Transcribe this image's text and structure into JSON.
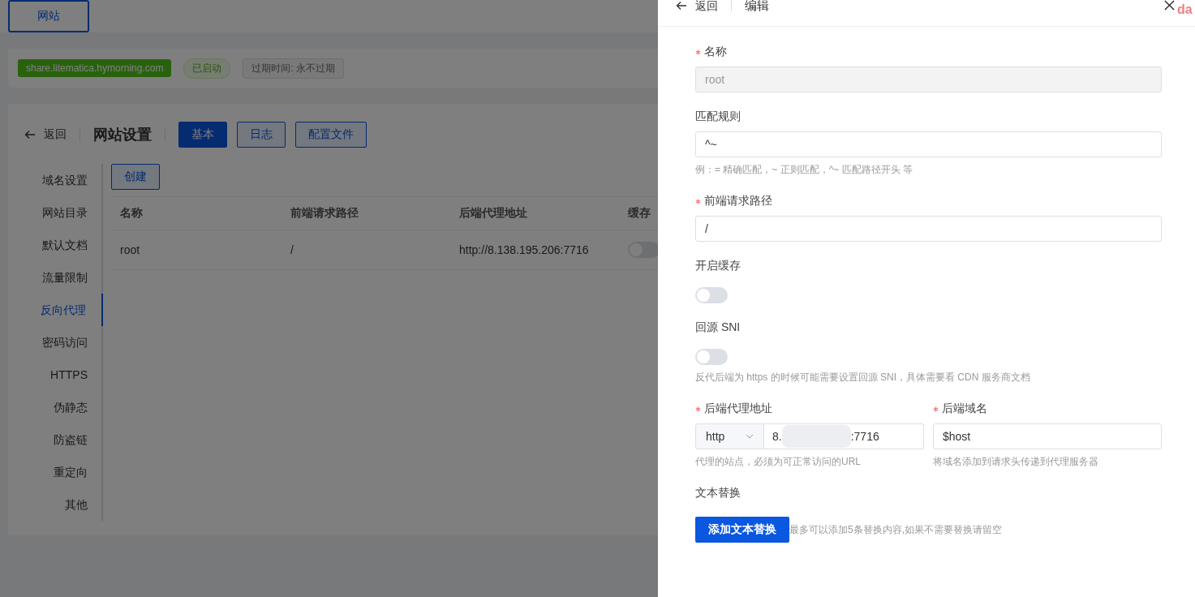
{
  "top_tabs": [
    {
      "label": "网站",
      "selected": true
    }
  ],
  "site": {
    "domain": "share.litematica.hymorning.com",
    "status": "已启动",
    "expiry": "过期时间: 永不过期"
  },
  "settings": {
    "back": "返回",
    "title": "网站设置",
    "tabs": [
      {
        "label": "基本",
        "selected": true
      },
      {
        "label": "日志",
        "selected": false
      },
      {
        "label": "配置文件",
        "selected": false
      }
    ],
    "sidebar": [
      {
        "label": "域名设置",
        "selected": false
      },
      {
        "label": "网站目录",
        "selected": false
      },
      {
        "label": "默认文档",
        "selected": false
      },
      {
        "label": "流量限制",
        "selected": false
      },
      {
        "label": "反向代理",
        "selected": true
      },
      {
        "label": "密码访问",
        "selected": false
      },
      {
        "label": "HTTPS",
        "selected": false
      },
      {
        "label": "伪静态",
        "selected": false
      },
      {
        "label": "防盗链",
        "selected": false
      },
      {
        "label": "重定向",
        "selected": false
      },
      {
        "label": "其他",
        "selected": false
      }
    ],
    "create_button": "创建",
    "table": {
      "columns": [
        "名称",
        "前端请求路径",
        "后端代理地址",
        "缓存"
      ],
      "rows": [
        {
          "name": "root",
          "path": "/",
          "backend": "http://8.138.195.206:7716",
          "cache_on": false
        }
      ]
    }
  },
  "drawer": {
    "back": "返回",
    "title": "编辑",
    "corner_text": "da",
    "fields": [
      {
        "kind": "text",
        "label": "名称",
        "required": true,
        "value": "root",
        "disabled": true
      },
      {
        "kind": "text",
        "label": "匹配规则",
        "required": false,
        "value": "^~",
        "disabled": false,
        "hint": "例：= 精确匹配，~ 正则匹配，^~ 匹配路径开头 等"
      },
      {
        "kind": "text",
        "label": "前端请求路径",
        "required": true,
        "value": "/",
        "disabled": false
      },
      {
        "kind": "toggle",
        "label": "开启缓存",
        "on": false
      },
      {
        "kind": "toggle",
        "label": "回源 SNI",
        "on": false,
        "hint": "反代后端为 https 的时候可能需要设置回源 SNI，具体需要看 CDN 服务商文档"
      },
      {
        "kind": "pair",
        "items": [
          {
            "kind": "proxy",
            "label": "后端代理地址",
            "required": true,
            "scheme": "http",
            "value_start": "8.",
            "value_end": ":7716",
            "hint": "代理的站点，必须为可正常访问的URL"
          },
          {
            "kind": "text",
            "label": "后端域名",
            "required": true,
            "value": "$host",
            "disabled": false,
            "hint": "将域名添加到请求头传递到代理服务器"
          }
        ]
      },
      {
        "kind": "action",
        "label": "文本替换",
        "button": "添加文本替换",
        "hint": "最多可以添加5条替换内容,如果不需要替换请留空"
      }
    ]
  }
}
